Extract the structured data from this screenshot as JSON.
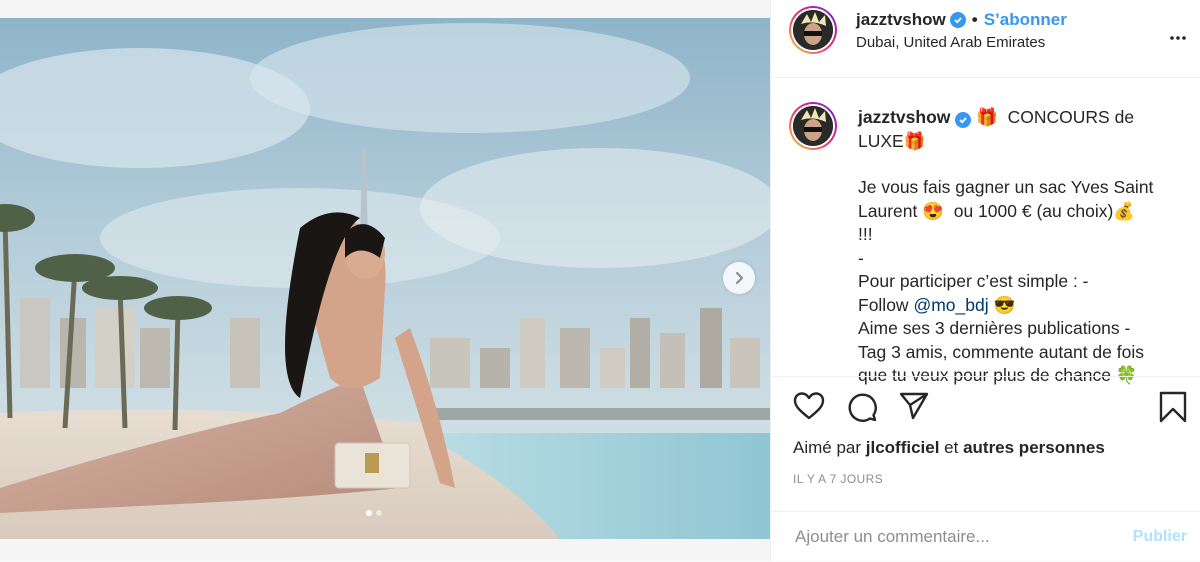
{
  "post": {
    "username": "jazztvshow",
    "separator": "•",
    "follow_label": "S’abonner",
    "location": "Dubai, United Arab Emirates",
    "more_icon": "more-horizontal-icon"
  },
  "caption": {
    "username": "jazztvshow",
    "line1": " 🎁  CONCOURS de LUXE🎁",
    "line2": "Je vous fais gagner un sac Yves Saint Laurent 😍  ou 1000 € (au choix)💰  !!!\n-\nPour participer c’est simple : -",
    "follow_word": "Follow ",
    "mention": "@mo_bdj",
    "line3": " 😎\nAime ses 3 dernières publications -\nTag 3 amis, commente autant de fois que tu veux pour plus de chance 🍀"
  },
  "actions": {
    "like_icon": "heart-icon",
    "comment_icon": "comment-icon",
    "share_icon": "share-icon",
    "save_icon": "bookmark-icon"
  },
  "likes": {
    "prefix": "Aimé par ",
    "user": "jlcofficiel",
    "middle": " et ",
    "suffix": "autres personnes"
  },
  "timestamp": "IL Y A 7 JOURS",
  "comment": {
    "placeholder": "Ajouter un commentaire...",
    "publish_label": "Publier"
  },
  "carousel": {
    "total_slides": 2,
    "current_slide": 1
  }
}
